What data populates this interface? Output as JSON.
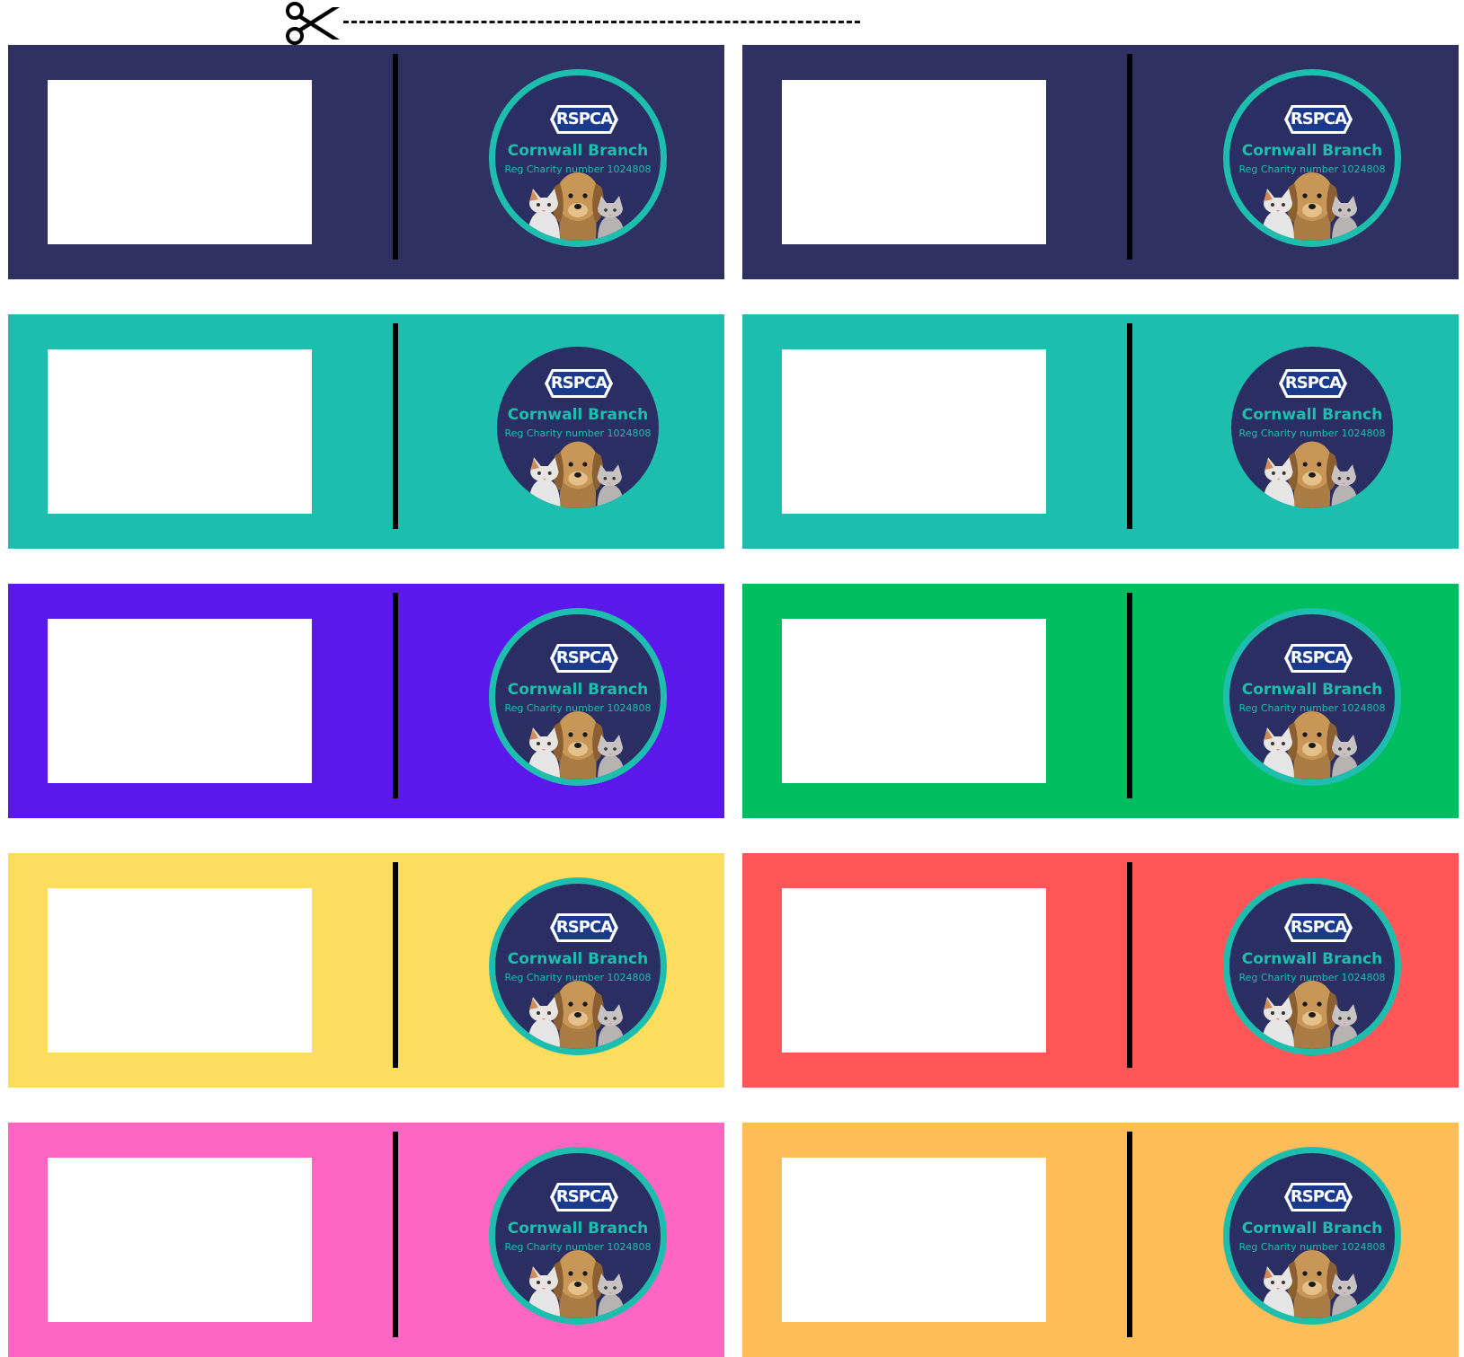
{
  "brand": {
    "logo_text": "RSPCA",
    "branch_name": "Cornwall Branch",
    "reg_text": "Reg Charity number 1024808"
  },
  "colors": {
    "badge_fill": "#2a2e62",
    "badge_ring": "#1ebeae",
    "fold_line": "#000000"
  },
  "cards": [
    {
      "bg": "#2f3163",
      "ring": "thick"
    },
    {
      "bg": "#2f3163",
      "ring": "thick"
    },
    {
      "bg": "#1ebeae",
      "ring": "thin"
    },
    {
      "bg": "#1ebeae",
      "ring": "thin"
    },
    {
      "bg": "#5c17eb",
      "ring": "thick"
    },
    {
      "bg": "#00be5f",
      "ring": "thick"
    },
    {
      "bg": "#fcdd5d",
      "ring": "thick"
    },
    {
      "bg": "#ff5757",
      "ring": "thick"
    },
    {
      "bg": "#ff66c4",
      "ring": "thick"
    },
    {
      "bg": "#fdbd59",
      "ring": "thick"
    }
  ]
}
